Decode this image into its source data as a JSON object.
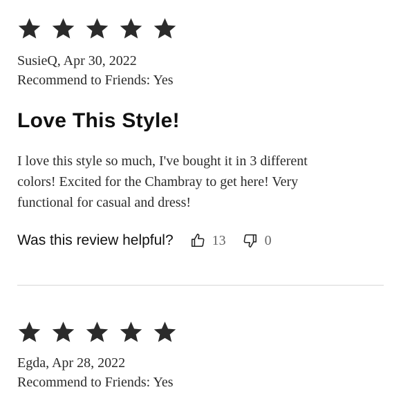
{
  "reviews": [
    {
      "rating": 5,
      "max_rating": 5,
      "author_date": "SusieQ, Apr 30, 2022",
      "recommend": "Recommend to Friends: Yes",
      "title": "Love This Style!",
      "body_lines": [
        "I love this style so much, I've bought it in 3 different",
        "colors! Excited for the Chambray to get here! Very",
        "functional for casual and dress!"
      ],
      "helpful_label": "Was this review helpful?",
      "helpful_yes": "13",
      "helpful_no": "0"
    },
    {
      "rating": 5,
      "max_rating": 5,
      "author_date": "Egda, Apr 28, 2022",
      "recommend": "Recommend to Friends: Yes"
    }
  ],
  "icons": {
    "star": "star-icon",
    "thumbs_up": "thumbs-up-icon",
    "thumbs_down": "thumbs-down-icon"
  },
  "colors": {
    "star": "#2b2b2b",
    "text": "#222222",
    "muted": "#666666",
    "divider": "#d6d6d6"
  }
}
